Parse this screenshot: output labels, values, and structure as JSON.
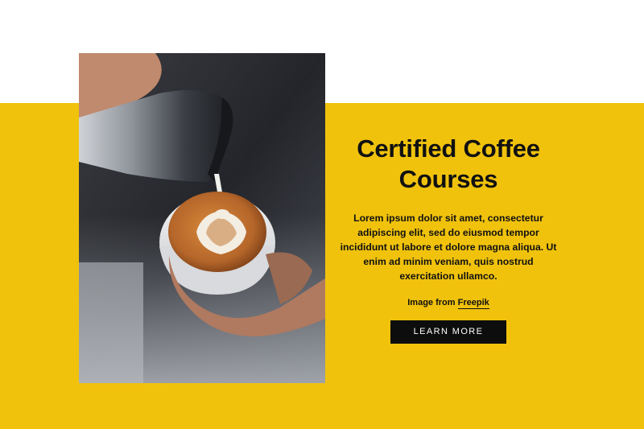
{
  "section": {
    "title_line1": "Certified Coffee",
    "title_line2": "Courses",
    "body": "Lorem ipsum dolor sit amet, consectetur adipiscing elit, sed do eiusmod tempor incididunt ut labore et dolore magna aliqua. Ut enim ad minim veniam, quis nostrud exercitation ullamco.",
    "credit_prefix": "Image from",
    "credit_link": "Freepik",
    "cta_label": "LEARN MORE"
  },
  "colors": {
    "accent_yellow": "#f0c20c",
    "button_black": "#0d0d0d",
    "text": "#111111"
  },
  "icons": []
}
